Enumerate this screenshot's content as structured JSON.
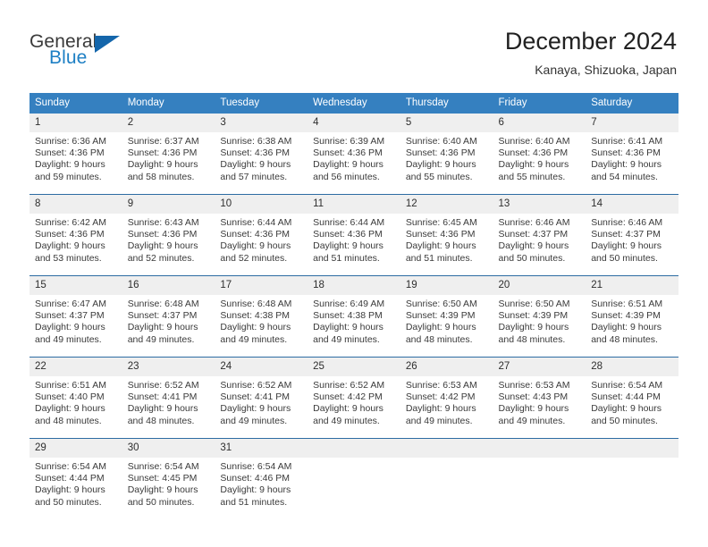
{
  "brand": {
    "name_primary": "General",
    "name_secondary": "Blue",
    "logo_icon": "triangle-flag-icon",
    "accent_color": "#1466ab",
    "secondary_color": "#1d7fc4"
  },
  "header": {
    "title": "December 2024",
    "subtitle": "Kanaya, Shizuoka, Japan"
  },
  "calendar": {
    "header_bg": "#3580c0",
    "daynum_bg": "#efefef",
    "weekday_headers": [
      "Sunday",
      "Monday",
      "Tuesday",
      "Wednesday",
      "Thursday",
      "Friday",
      "Saturday"
    ],
    "weeks": [
      [
        {
          "day": "1",
          "sunrise": "Sunrise: 6:36 AM",
          "sunset": "Sunset: 4:36 PM",
          "daylight_line1": "Daylight: 9 hours",
          "daylight_line2": "and 59 minutes."
        },
        {
          "day": "2",
          "sunrise": "Sunrise: 6:37 AM",
          "sunset": "Sunset: 4:36 PM",
          "daylight_line1": "Daylight: 9 hours",
          "daylight_line2": "and 58 minutes."
        },
        {
          "day": "3",
          "sunrise": "Sunrise: 6:38 AM",
          "sunset": "Sunset: 4:36 PM",
          "daylight_line1": "Daylight: 9 hours",
          "daylight_line2": "and 57 minutes."
        },
        {
          "day": "4",
          "sunrise": "Sunrise: 6:39 AM",
          "sunset": "Sunset: 4:36 PM",
          "daylight_line1": "Daylight: 9 hours",
          "daylight_line2": "and 56 minutes."
        },
        {
          "day": "5",
          "sunrise": "Sunrise: 6:40 AM",
          "sunset": "Sunset: 4:36 PM",
          "daylight_line1": "Daylight: 9 hours",
          "daylight_line2": "and 55 minutes."
        },
        {
          "day": "6",
          "sunrise": "Sunrise: 6:40 AM",
          "sunset": "Sunset: 4:36 PM",
          "daylight_line1": "Daylight: 9 hours",
          "daylight_line2": "and 55 minutes."
        },
        {
          "day": "7",
          "sunrise": "Sunrise: 6:41 AM",
          "sunset": "Sunset: 4:36 PM",
          "daylight_line1": "Daylight: 9 hours",
          "daylight_line2": "and 54 minutes."
        }
      ],
      [
        {
          "day": "8",
          "sunrise": "Sunrise: 6:42 AM",
          "sunset": "Sunset: 4:36 PM",
          "daylight_line1": "Daylight: 9 hours",
          "daylight_line2": "and 53 minutes."
        },
        {
          "day": "9",
          "sunrise": "Sunrise: 6:43 AM",
          "sunset": "Sunset: 4:36 PM",
          "daylight_line1": "Daylight: 9 hours",
          "daylight_line2": "and 52 minutes."
        },
        {
          "day": "10",
          "sunrise": "Sunrise: 6:44 AM",
          "sunset": "Sunset: 4:36 PM",
          "daylight_line1": "Daylight: 9 hours",
          "daylight_line2": "and 52 minutes."
        },
        {
          "day": "11",
          "sunrise": "Sunrise: 6:44 AM",
          "sunset": "Sunset: 4:36 PM",
          "daylight_line1": "Daylight: 9 hours",
          "daylight_line2": "and 51 minutes."
        },
        {
          "day": "12",
          "sunrise": "Sunrise: 6:45 AM",
          "sunset": "Sunset: 4:36 PM",
          "daylight_line1": "Daylight: 9 hours",
          "daylight_line2": "and 51 minutes."
        },
        {
          "day": "13",
          "sunrise": "Sunrise: 6:46 AM",
          "sunset": "Sunset: 4:37 PM",
          "daylight_line1": "Daylight: 9 hours",
          "daylight_line2": "and 50 minutes."
        },
        {
          "day": "14",
          "sunrise": "Sunrise: 6:46 AM",
          "sunset": "Sunset: 4:37 PM",
          "daylight_line1": "Daylight: 9 hours",
          "daylight_line2": "and 50 minutes."
        }
      ],
      [
        {
          "day": "15",
          "sunrise": "Sunrise: 6:47 AM",
          "sunset": "Sunset: 4:37 PM",
          "daylight_line1": "Daylight: 9 hours",
          "daylight_line2": "and 49 minutes."
        },
        {
          "day": "16",
          "sunrise": "Sunrise: 6:48 AM",
          "sunset": "Sunset: 4:37 PM",
          "daylight_line1": "Daylight: 9 hours",
          "daylight_line2": "and 49 minutes."
        },
        {
          "day": "17",
          "sunrise": "Sunrise: 6:48 AM",
          "sunset": "Sunset: 4:38 PM",
          "daylight_line1": "Daylight: 9 hours",
          "daylight_line2": "and 49 minutes."
        },
        {
          "day": "18",
          "sunrise": "Sunrise: 6:49 AM",
          "sunset": "Sunset: 4:38 PM",
          "daylight_line1": "Daylight: 9 hours",
          "daylight_line2": "and 49 minutes."
        },
        {
          "day": "19",
          "sunrise": "Sunrise: 6:50 AM",
          "sunset": "Sunset: 4:39 PM",
          "daylight_line1": "Daylight: 9 hours",
          "daylight_line2": "and 48 minutes."
        },
        {
          "day": "20",
          "sunrise": "Sunrise: 6:50 AM",
          "sunset": "Sunset: 4:39 PM",
          "daylight_line1": "Daylight: 9 hours",
          "daylight_line2": "and 48 minutes."
        },
        {
          "day": "21",
          "sunrise": "Sunrise: 6:51 AM",
          "sunset": "Sunset: 4:39 PM",
          "daylight_line1": "Daylight: 9 hours",
          "daylight_line2": "and 48 minutes."
        }
      ],
      [
        {
          "day": "22",
          "sunrise": "Sunrise: 6:51 AM",
          "sunset": "Sunset: 4:40 PM",
          "daylight_line1": "Daylight: 9 hours",
          "daylight_line2": "and 48 minutes."
        },
        {
          "day": "23",
          "sunrise": "Sunrise: 6:52 AM",
          "sunset": "Sunset: 4:41 PM",
          "daylight_line1": "Daylight: 9 hours",
          "daylight_line2": "and 48 minutes."
        },
        {
          "day": "24",
          "sunrise": "Sunrise: 6:52 AM",
          "sunset": "Sunset: 4:41 PM",
          "daylight_line1": "Daylight: 9 hours",
          "daylight_line2": "and 49 minutes."
        },
        {
          "day": "25",
          "sunrise": "Sunrise: 6:52 AM",
          "sunset": "Sunset: 4:42 PM",
          "daylight_line1": "Daylight: 9 hours",
          "daylight_line2": "and 49 minutes."
        },
        {
          "day": "26",
          "sunrise": "Sunrise: 6:53 AM",
          "sunset": "Sunset: 4:42 PM",
          "daylight_line1": "Daylight: 9 hours",
          "daylight_line2": "and 49 minutes."
        },
        {
          "day": "27",
          "sunrise": "Sunrise: 6:53 AM",
          "sunset": "Sunset: 4:43 PM",
          "daylight_line1": "Daylight: 9 hours",
          "daylight_line2": "and 49 minutes."
        },
        {
          "day": "28",
          "sunrise": "Sunrise: 6:54 AM",
          "sunset": "Sunset: 4:44 PM",
          "daylight_line1": "Daylight: 9 hours",
          "daylight_line2": "and 50 minutes."
        }
      ],
      [
        {
          "day": "29",
          "sunrise": "Sunrise: 6:54 AM",
          "sunset": "Sunset: 4:44 PM",
          "daylight_line1": "Daylight: 9 hours",
          "daylight_line2": "and 50 minutes."
        },
        {
          "day": "30",
          "sunrise": "Sunrise: 6:54 AM",
          "sunset": "Sunset: 4:45 PM",
          "daylight_line1": "Daylight: 9 hours",
          "daylight_line2": "and 50 minutes."
        },
        {
          "day": "31",
          "sunrise": "Sunrise: 6:54 AM",
          "sunset": "Sunset: 4:46 PM",
          "daylight_line1": "Daylight: 9 hours",
          "daylight_line2": "and 51 minutes."
        },
        {
          "day": "",
          "sunrise": "",
          "sunset": "",
          "daylight_line1": "",
          "daylight_line2": ""
        },
        {
          "day": "",
          "sunrise": "",
          "sunset": "",
          "daylight_line1": "",
          "daylight_line2": ""
        },
        {
          "day": "",
          "sunrise": "",
          "sunset": "",
          "daylight_line1": "",
          "daylight_line2": ""
        },
        {
          "day": "",
          "sunrise": "",
          "sunset": "",
          "daylight_line1": "",
          "daylight_line2": ""
        }
      ]
    ]
  }
}
